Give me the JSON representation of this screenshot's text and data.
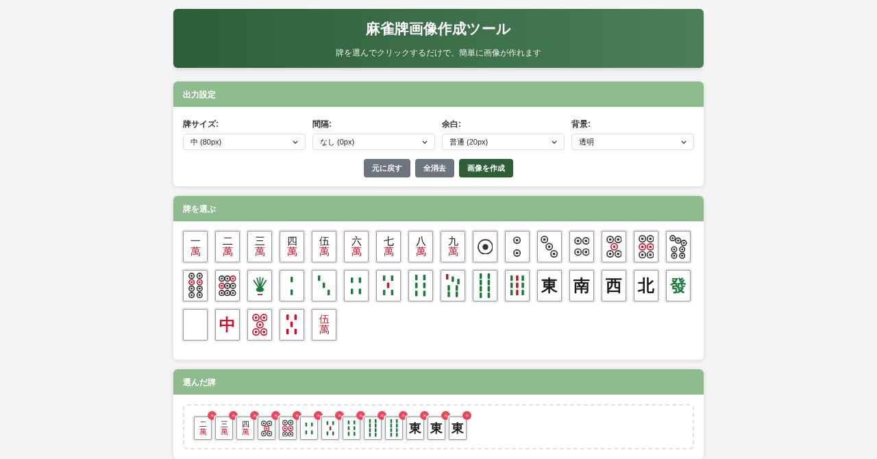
{
  "header": {
    "title": "麻雀牌画像作成ツール",
    "subtitle": "牌を選んでクリックするだけで、簡単に画像が作れます"
  },
  "settings": {
    "title": "出力設定",
    "fields": [
      {
        "label": "牌サイズ:",
        "value": "中 (80px)"
      },
      {
        "label": "間隔:",
        "value": "なし (0px)"
      },
      {
        "label": "余白:",
        "value": "普通 (20px)"
      },
      {
        "label": "背景:",
        "value": "透明"
      }
    ],
    "buttons": [
      {
        "label": "元に戻す",
        "kind": "secondary"
      },
      {
        "label": "全消去",
        "kind": "secondary"
      },
      {
        "label": "画像を作成",
        "kind": "primary"
      }
    ]
  },
  "palette": {
    "title": "牌を選ぶ",
    "tiles": [
      {
        "kind": "man",
        "top": "一",
        "bottom": "萬",
        "red": false
      },
      {
        "kind": "man",
        "top": "二",
        "bottom": "萬",
        "red": false
      },
      {
        "kind": "man",
        "top": "三",
        "bottom": "萬",
        "red": false
      },
      {
        "kind": "man",
        "top": "四",
        "bottom": "萬",
        "red": false
      },
      {
        "kind": "man",
        "top": "伍",
        "bottom": "萬",
        "red": false
      },
      {
        "kind": "man",
        "top": "六",
        "bottom": "萬",
        "red": false
      },
      {
        "kind": "man",
        "top": "七",
        "bottom": "萬",
        "red": false
      },
      {
        "kind": "man",
        "top": "八",
        "bottom": "萬",
        "red": false
      },
      {
        "kind": "man",
        "top": "九",
        "bottom": "萬",
        "red": false
      },
      {
        "kind": "pin1",
        "red": false
      },
      {
        "kind": "pin2",
        "red": false
      },
      {
        "kind": "pin3",
        "red": false
      },
      {
        "kind": "pin4",
        "red": false
      },
      {
        "kind": "pin5",
        "red": false
      },
      {
        "kind": "pin6",
        "red": false
      },
      {
        "kind": "pin7",
        "red": false
      },
      {
        "kind": "pin8",
        "red": false
      },
      {
        "kind": "pin9",
        "red": false
      },
      {
        "kind": "sou1",
        "red": false
      },
      {
        "kind": "sou2",
        "red": false
      },
      {
        "kind": "sou3",
        "red": false
      },
      {
        "kind": "sou4",
        "red": false
      },
      {
        "kind": "sou5",
        "red": false
      },
      {
        "kind": "sou6",
        "red": false
      },
      {
        "kind": "sou7",
        "red": false
      },
      {
        "kind": "sou8",
        "red": false
      },
      {
        "kind": "sou9",
        "red": false
      },
      {
        "kind": "honor",
        "char": "東",
        "color": "#1a1a1a"
      },
      {
        "kind": "honor",
        "char": "南",
        "color": "#1a1a1a"
      },
      {
        "kind": "honor",
        "char": "西",
        "color": "#1a1a1a"
      },
      {
        "kind": "honor",
        "char": "北",
        "color": "#1a1a1a"
      },
      {
        "kind": "honor",
        "char": "發",
        "color": "#1b7a3a"
      },
      {
        "kind": "blank"
      },
      {
        "kind": "honor",
        "char": "中",
        "color": "#d0102a"
      },
      {
        "kind": "pin5",
        "red": true
      },
      {
        "kind": "sou5",
        "red": true
      },
      {
        "kind": "man",
        "top": "伍",
        "bottom": "萬",
        "red": true
      }
    ]
  },
  "selected": {
    "title": "選んだ牌",
    "remove_mark": "×",
    "tiles": [
      {
        "kind": "man",
        "top": "二",
        "bottom": "萬",
        "red": false
      },
      {
        "kind": "man",
        "top": "三",
        "bottom": "萬",
        "red": false
      },
      {
        "kind": "man",
        "top": "四",
        "bottom": "萬",
        "red": false
      },
      {
        "kind": "pin5",
        "red": false
      },
      {
        "kind": "pin6",
        "red": false
      },
      {
        "kind": "sou4",
        "red": false
      },
      {
        "kind": "sou5",
        "red": false
      },
      {
        "kind": "sou6",
        "red": false
      },
      {
        "kind": "sou8",
        "red": false
      },
      {
        "kind": "sou8",
        "red": false
      },
      {
        "kind": "honor",
        "char": "東",
        "color": "#1a1a1a"
      },
      {
        "kind": "honor",
        "char": "東",
        "color": "#1a1a1a"
      },
      {
        "kind": "honor",
        "char": "東",
        "color": "#1a1a1a"
      }
    ]
  }
}
